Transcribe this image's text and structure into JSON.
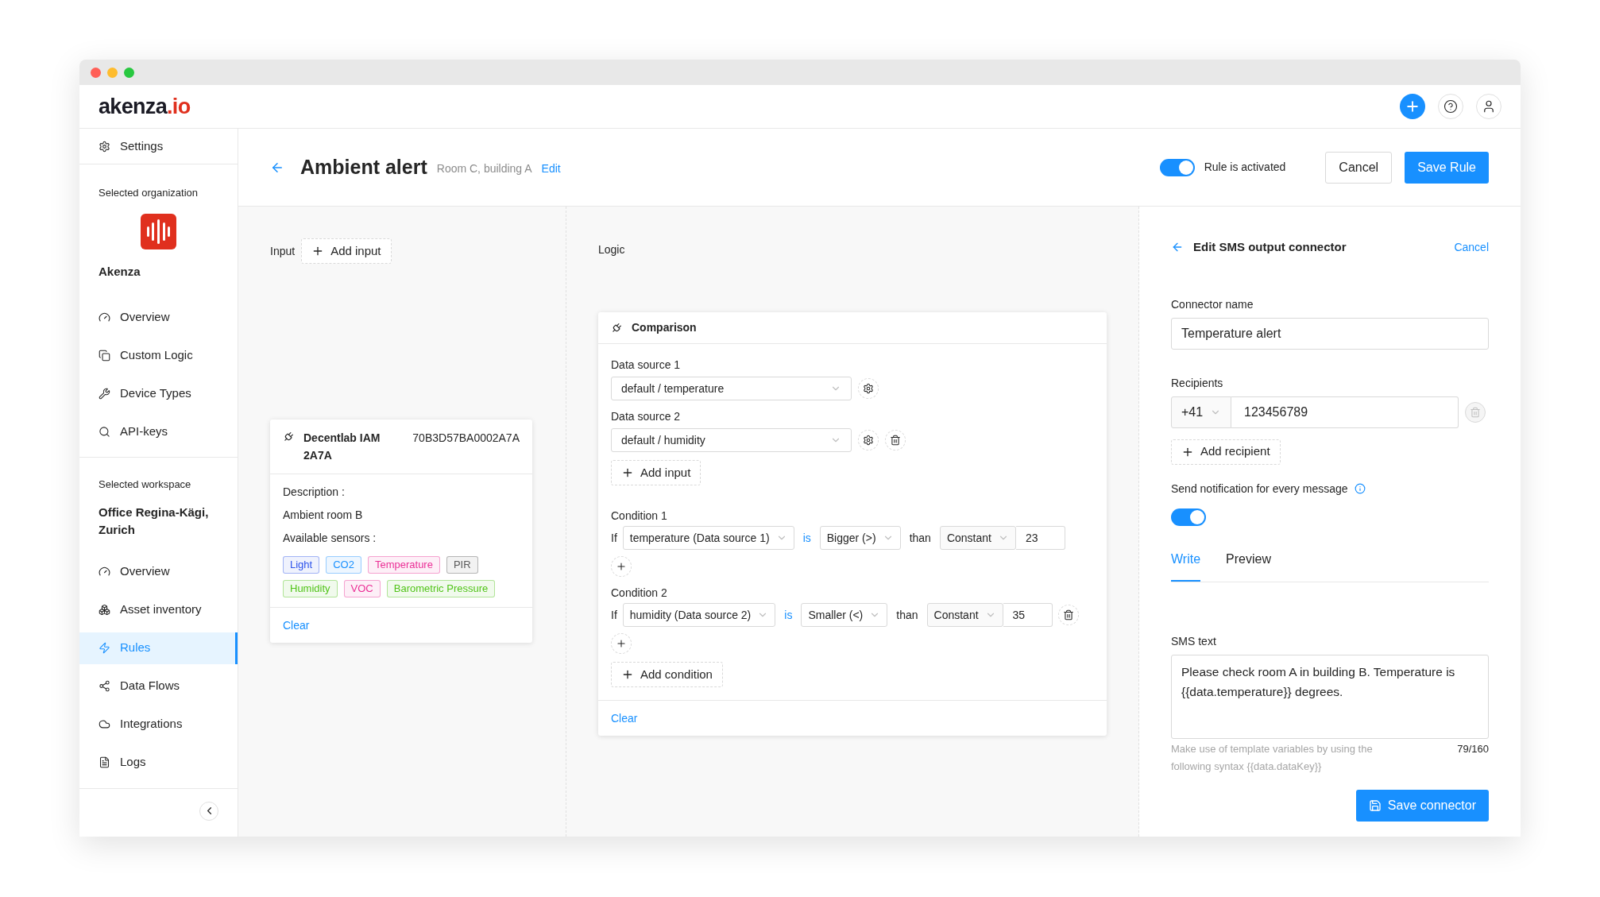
{
  "logo": {
    "name": "akenza",
    "tld": ".io"
  },
  "sidebar": {
    "settings": "Settings",
    "organization_label": "Selected organization",
    "organization_name": "Akenza",
    "organization_items": [
      {
        "label": "Overview",
        "selected": false
      },
      {
        "label": "Custom Logic",
        "selected": false
      },
      {
        "label": "Device Types",
        "selected": false
      },
      {
        "label": "API-keys",
        "selected": false
      }
    ],
    "workspace_label": "Selected workspace",
    "workspace_name": "Office Regina-Kägi, Zurich",
    "workspace_items": [
      {
        "label": "Overview",
        "selected": false
      },
      {
        "label": "Asset inventory",
        "selected": false
      },
      {
        "label": "Rules",
        "selected": true
      },
      {
        "label": "Data Flows",
        "selected": false
      },
      {
        "label": "Integrations",
        "selected": false
      },
      {
        "label": "Logs",
        "selected": false
      }
    ]
  },
  "rule": {
    "title": "Ambient alert",
    "subtitle": "Room C, building A",
    "edit": "Edit",
    "activated": {
      "label": "Rule is activated",
      "on": true
    },
    "cancel": "Cancel",
    "save": "Save Rule"
  },
  "input": {
    "label": "Input",
    "add": "Add input",
    "device": {
      "name": "Decentlab IAM 2A7A",
      "id": "70B3D57BA0002A7A",
      "description_label": "Description :",
      "description": "Ambient room B",
      "sensors_label": "Available sensors :",
      "sensors": [
        {
          "label": "Light",
          "color": "#2f54eb"
        },
        {
          "label": "CO2",
          "color": "#1890ff"
        },
        {
          "label": "Temperature",
          "color": "#eb2f96"
        },
        {
          "label": "PIR",
          "color": "#595959"
        },
        {
          "label": "Humidity",
          "color": "#52c41a"
        },
        {
          "label": "VOC",
          "color": "#eb2f96"
        },
        {
          "label": "Barometric Pressure",
          "color": "#52c41a"
        }
      ],
      "clear": "Clear"
    }
  },
  "logic": {
    "label": "Logic",
    "card": {
      "title": "Comparison",
      "sources": [
        {
          "label": "Data source 1",
          "value": "default / temperature",
          "deletable": false
        },
        {
          "label": "Data source 2",
          "value": "default / humidity",
          "deletable": true
        }
      ],
      "add_input": "Add input",
      "conditions": [
        {
          "label": "Condition 1",
          "if": "If",
          "field": "temperature (Data source 1)",
          "is": "is",
          "operator": "Bigger (>)",
          "than": "than",
          "type": "Constant",
          "value": "23",
          "deletable": false
        },
        {
          "label": "Condition 2",
          "if": "If",
          "field": "humidity (Data source 2)",
          "is": "is",
          "operator": "Smaller (<)",
          "than": "than",
          "type": "Constant",
          "value": "35",
          "deletable": true
        }
      ],
      "add_condition": "Add condition",
      "clear": "Clear"
    }
  },
  "connector": {
    "title": "Edit SMS output connector",
    "cancel": "Cancel",
    "name_label": "Connector name",
    "name_value": "Temperature alert",
    "recipients_label": "Recipients",
    "recipients": [
      {
        "country_code": "+41",
        "number": "123456789"
      }
    ],
    "add_recipient": "Add recipient",
    "notify": {
      "label": "Send notification for every message",
      "on": true
    },
    "tabs": [
      {
        "label": "Write",
        "selected": true
      },
      {
        "label": "Preview",
        "selected": false
      }
    ],
    "sms_label": "SMS text",
    "sms_value": "Please check room A in building B. Temperature is {{data.temperature}} degrees.",
    "hint": "Make use of template variables by using the following syntax {{data.dataKey}}",
    "counter": "79/160",
    "save": "Save connector"
  }
}
